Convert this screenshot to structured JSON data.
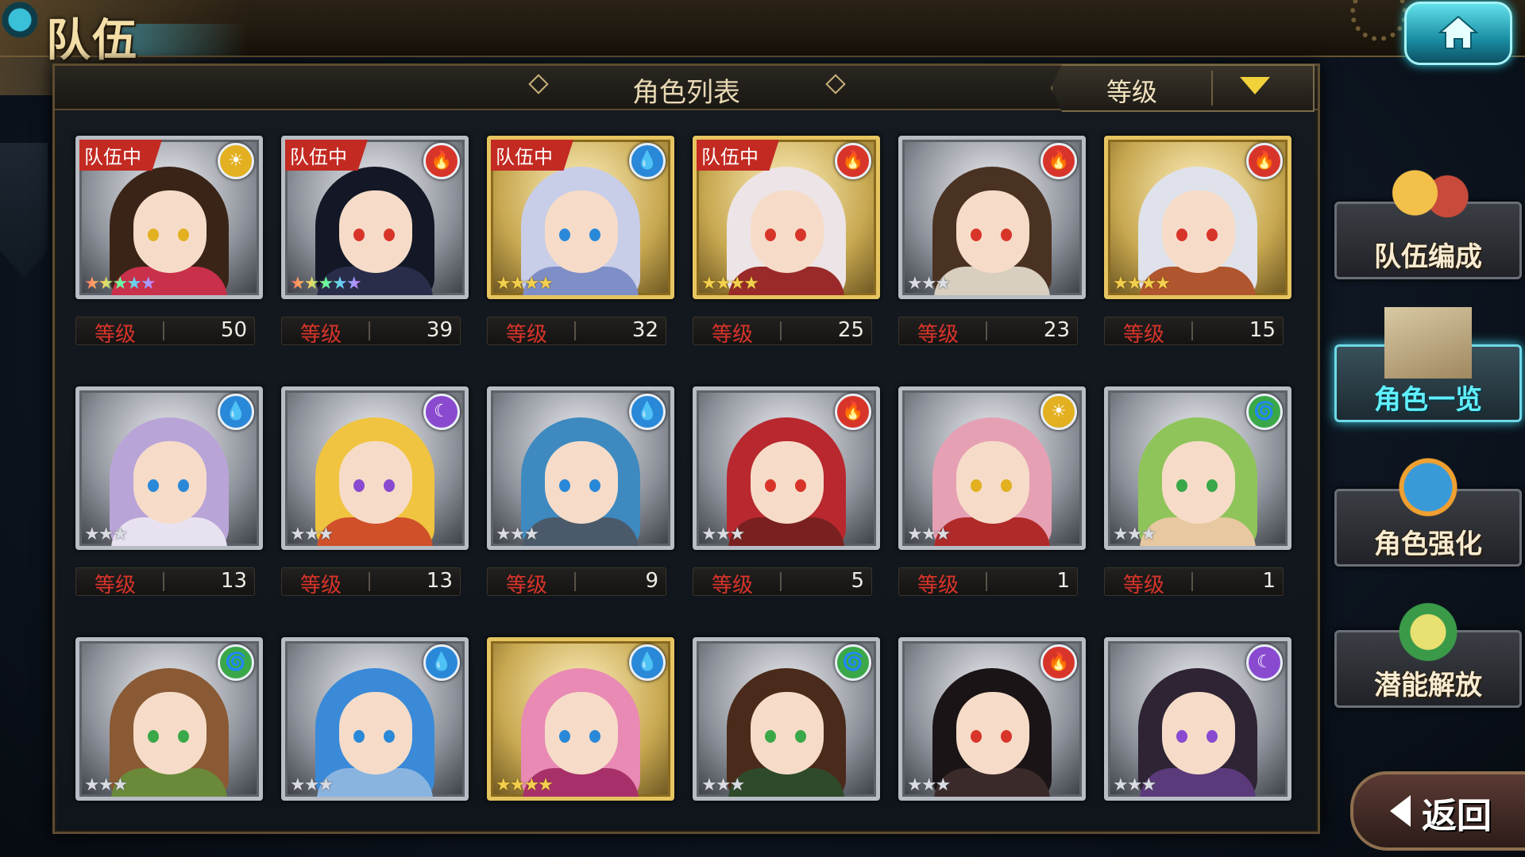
{
  "screen": {
    "title": "队伍"
  },
  "panel": {
    "title": "角色列表",
    "sort": {
      "label": "等级"
    }
  },
  "level_label": "等级",
  "in_team_badge": "队伍中",
  "characters": [
    {
      "in_team": true,
      "element": "light",
      "stars": 5,
      "level": "50",
      "frame": "silver",
      "hair": "#3a2418",
      "outfit": "#c9304a"
    },
    {
      "in_team": true,
      "element": "fire",
      "stars": 5,
      "level": "39",
      "frame": "silver",
      "hair": "#141826",
      "outfit": "#2a2d4a"
    },
    {
      "in_team": true,
      "element": "water",
      "stars": 4,
      "level": "32",
      "frame": "gold",
      "hair": "#c8cde8",
      "outfit": "#7e8fc8"
    },
    {
      "in_team": true,
      "element": "fire",
      "stars": 4,
      "level": "25",
      "frame": "gold",
      "hair": "#ece4e6",
      "outfit": "#9a2a2a"
    },
    {
      "in_team": false,
      "element": "fire",
      "stars": 3,
      "level": "23",
      "frame": "silver",
      "hair": "#4a3222",
      "outfit": "#d8cfc0"
    },
    {
      "in_team": false,
      "element": "fire",
      "stars": 4,
      "level": "15",
      "frame": "gold",
      "hair": "#dfe2ea",
      "outfit": "#b0562e"
    },
    {
      "in_team": false,
      "element": "water",
      "stars": 3,
      "level": "13",
      "frame": "silver",
      "hair": "#b9a4d8",
      "outfit": "#e8e2f0"
    },
    {
      "in_team": false,
      "element": "dark",
      "stars": 3,
      "level": "13",
      "frame": "silver",
      "hair": "#f0c440",
      "outfit": "#d0502a"
    },
    {
      "in_team": false,
      "element": "water",
      "stars": 3,
      "level": "9",
      "frame": "silver",
      "hair": "#3e8ac0",
      "outfit": "#4a5a6a"
    },
    {
      "in_team": false,
      "element": "fire",
      "stars": 3,
      "level": "5",
      "frame": "silver",
      "hair": "#b8282e",
      "outfit": "#7a2020"
    },
    {
      "in_team": false,
      "element": "light",
      "stars": 3,
      "level": "1",
      "frame": "silver",
      "hair": "#e6a0b4",
      "outfit": "#b02a2a"
    },
    {
      "in_team": false,
      "element": "wind",
      "stars": 3,
      "level": "1",
      "frame": "silver",
      "hair": "#8fc45a",
      "outfit": "#e8c8a0"
    },
    {
      "in_team": false,
      "element": "wind",
      "stars": 3,
      "level": null,
      "frame": "silver",
      "hair": "#8a5a34",
      "outfit": "#6a8a3a"
    },
    {
      "in_team": false,
      "element": "water",
      "stars": 3,
      "level": null,
      "frame": "silver",
      "hair": "#3a8ad8",
      "outfit": "#8ab4e0"
    },
    {
      "in_team": false,
      "element": "water",
      "stars": 4,
      "level": null,
      "frame": "gold",
      "hair": "#e88ab4",
      "outfit": "#a8306a"
    },
    {
      "in_team": false,
      "element": "wind",
      "stars": 3,
      "level": null,
      "frame": "silver",
      "hair": "#4a2a1a",
      "outfit": "#2e4a2a"
    },
    {
      "in_team": false,
      "element": "fire",
      "stars": 3,
      "level": null,
      "frame": "silver",
      "hair": "#1a1416",
      "outfit": "#3a2a2a"
    },
    {
      "in_team": false,
      "element": "dark",
      "stars": 3,
      "level": null,
      "frame": "silver",
      "hair": "#2e2434",
      "outfit": "#5a3a7a"
    }
  ],
  "side_menu": [
    {
      "label": "队伍编成",
      "active": false
    },
    {
      "label": "角色一览",
      "active": true
    },
    {
      "label": "角色强化",
      "active": false
    },
    {
      "label": "潜能解放",
      "active": false
    }
  ],
  "back": {
    "label": "返回"
  },
  "colors": {
    "fire": "#d8352a",
    "water": "#2a88d8",
    "light": "#e2b020",
    "dark": "#8a4ad0",
    "wind": "#3aa848"
  }
}
